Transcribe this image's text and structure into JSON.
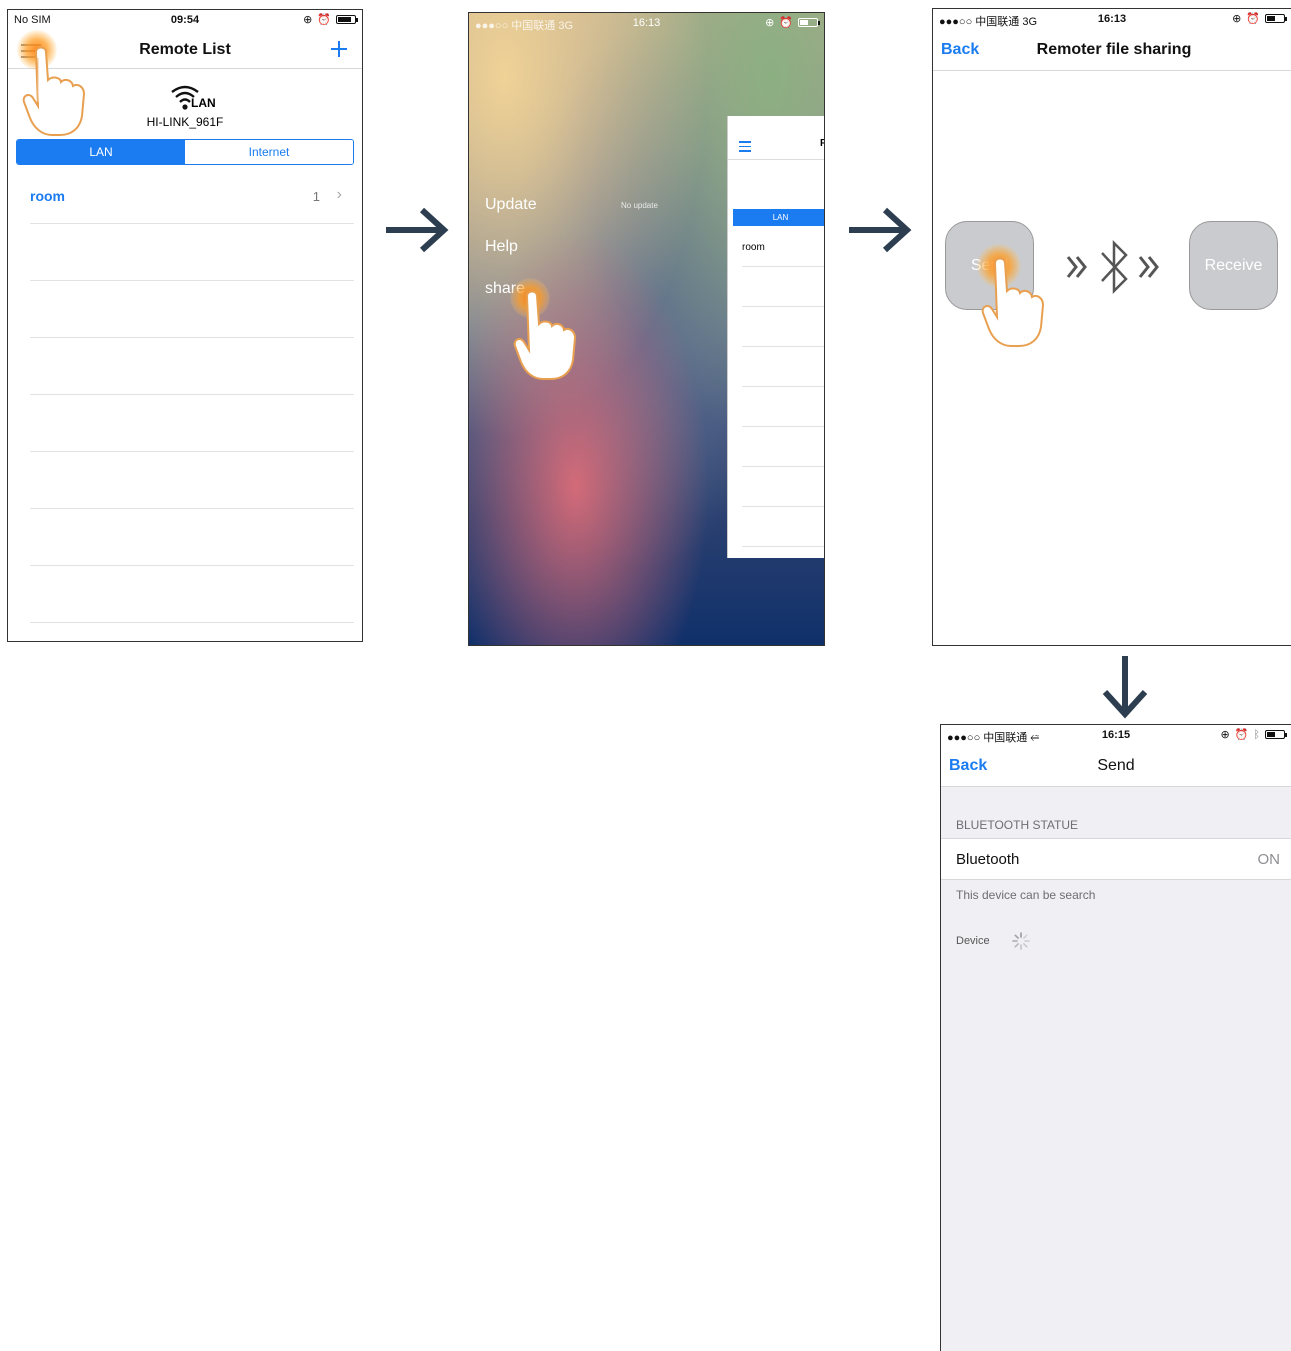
{
  "screen1": {
    "status": {
      "carrier": "No SIM",
      "time": "09:54"
    },
    "title": "Remote List",
    "add_icon": "plus-icon",
    "network_label": "LAN",
    "device_name": "HI-LINK_961F",
    "segments": [
      "LAN",
      "Internet"
    ],
    "list": [
      {
        "name": "room",
        "count": "1"
      }
    ]
  },
  "screen2": {
    "status": {
      "carrier": "●●●○○ 中国联通  3G",
      "time": "16:13"
    },
    "menu": [
      {
        "label": "Update",
        "note": "No update"
      },
      {
        "label": "Help"
      },
      {
        "label": "share"
      }
    ],
    "peek": {
      "segment": "LAN",
      "row": "room",
      "title_fragment": "R"
    }
  },
  "screen3": {
    "status": {
      "carrier": "●●●○○ 中国联通  3G",
      "time": "16:13"
    },
    "back": "Back",
    "title": "Remoter file sharing",
    "send_button": "Send",
    "receive_button": "Receive"
  },
  "screen4": {
    "status": {
      "carrier": "●●●○○ 中国联通",
      "time": "16:15"
    },
    "back": "Back",
    "title": "Send",
    "section_header": "BLUETOOTH STATUE",
    "bluetooth_label": "Bluetooth",
    "bluetooth_value": "ON",
    "footer_note": "This device can be search",
    "device_label": "Device"
  },
  "colors": {
    "accent": "#1a7cf0",
    "arrow": "#2c3e50",
    "tap": "#ff8c1a",
    "grey_button": "#c9cbce"
  }
}
